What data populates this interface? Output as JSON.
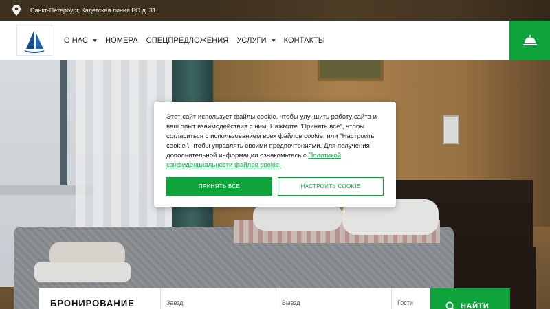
{
  "topbar": {
    "address": "Санкт-Петербург, Кадетская линия ВО д. 31."
  },
  "nav": {
    "items": [
      {
        "label": "О НАС",
        "has_dropdown": true
      },
      {
        "label": "НОМЕРА",
        "has_dropdown": false
      },
      {
        "label": "СПЕЦПРЕДЛОЖЕНИЯ",
        "has_dropdown": false
      },
      {
        "label": "УСЛУГИ",
        "has_dropdown": true
      },
      {
        "label": "КОНТАКТЫ",
        "has_dropdown": false
      }
    ]
  },
  "cookie": {
    "text": "Этот сайт использует файлы cookie, чтобы улучшить работу сайта и ваш опыт взаимодействия с ним. Нажмите \"Принять все\", чтобы согласиться с использованием всех файлов cookie, или \"Настроить cookie\", чтобы управлять своими предпочтениями. Для получения дополнительной информации ознакомьтесь с ",
    "link_text": "Политикой конфиденциальности файлов cookie.",
    "accept_label": "ПРИНЯТЬ ВСЕ",
    "configure_label": "НАСТРОИТЬ COOKIE"
  },
  "booking": {
    "title": "БРОНИРОВАНИЕ",
    "checkin_label": "Заезд",
    "checkout_label": "Выезд",
    "guests_label": "Гости",
    "find_label": "НАЙТИ"
  },
  "colors": {
    "accent": "#0fa43b",
    "header_bg": "#ffffff",
    "topbar_bg": "#14120e"
  },
  "icons": {
    "topbar": "map-pin-icon",
    "header_right": "reception-bell-icon",
    "find": "search-icon"
  }
}
